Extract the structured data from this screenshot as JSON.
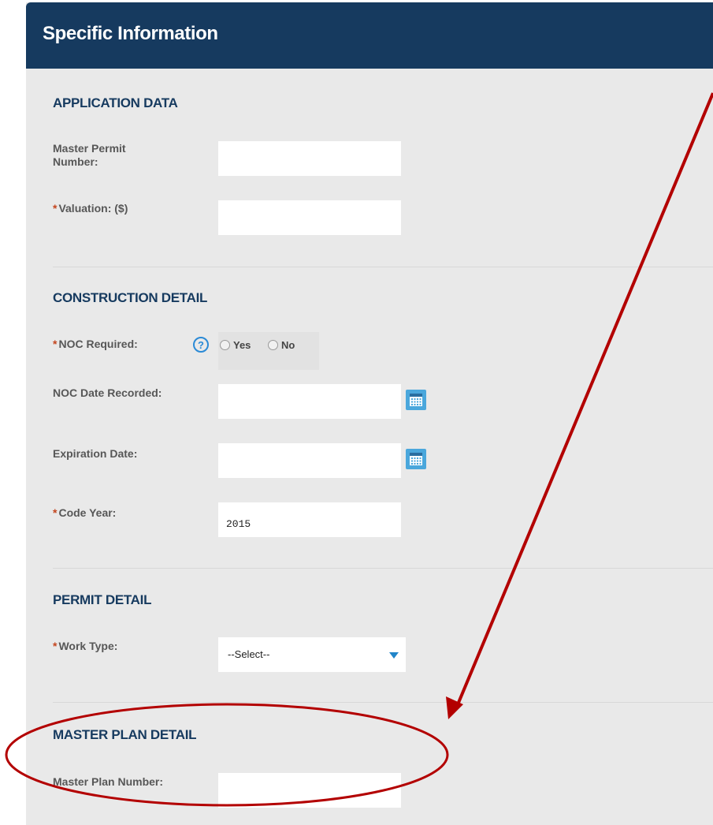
{
  "panel": {
    "title": "Specific Information"
  },
  "sections": {
    "application_data": {
      "title": "APPLICATION DATA",
      "master_permit_label": "Master Permit Number:",
      "master_permit_value": "",
      "valuation_label": "Valuation: ($)",
      "valuation_value": ""
    },
    "construction_detail": {
      "title": "CONSTRUCTION DETAIL",
      "noc_required_label": "NOC Required:",
      "noc_options": [
        "Yes",
        "No"
      ],
      "help_glyph": "?",
      "noc_date_label": "NOC Date Recorded:",
      "noc_date_value": "",
      "expiration_label": "Expiration Date:",
      "expiration_value": "",
      "code_year_label": "Code Year:",
      "code_year_value": "2015"
    },
    "permit_detail": {
      "title": "PERMIT DETAIL",
      "work_type_label": "Work Type:",
      "work_type_value": "--Select--"
    },
    "master_plan_detail": {
      "title": "MASTER PLAN DETAIL",
      "master_plan_label": "Master Plan Number:",
      "master_plan_value": ""
    }
  },
  "required_marker": "*",
  "icons": {
    "help": "question-circle-icon",
    "calendar": "calendar-icon",
    "dropdown": "caret-down-icon"
  },
  "colors": {
    "header": "#163a5f",
    "panel_bg": "#e9e9e9",
    "required": "#c4461f",
    "calendar": "#4aa7dc",
    "annotation": "#b30000"
  }
}
